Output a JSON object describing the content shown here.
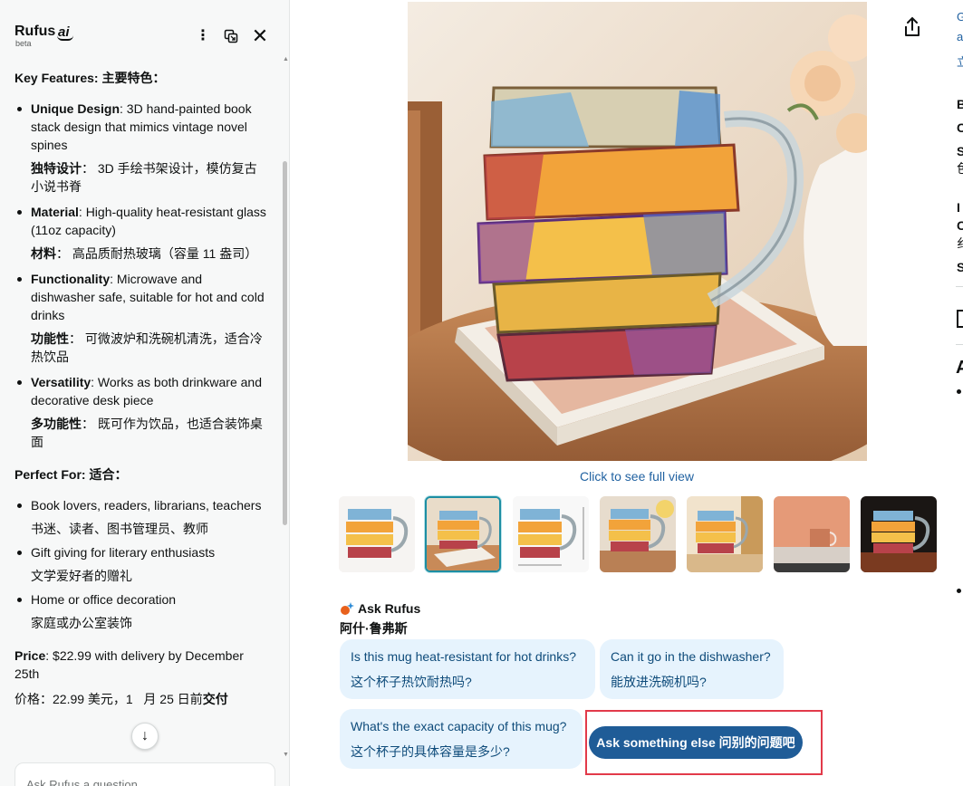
{
  "rufus": {
    "brand": "Rufus",
    "brand_ai": "ai",
    "brand_beta": "beta",
    "more_icon": "⋮",
    "close_icon": "✕",
    "key_features_title": "Key Features: 主要特色：",
    "features": [
      {
        "label_en": "Unique Design",
        "text_en": ": 3D hand-painted book stack design that mimics vintage novel spines",
        "label_zh": "独特设计",
        "text_zh": "： 3D 手绘书架设计，模仿复古小说书脊"
      },
      {
        "label_en": "Material",
        "text_en": ": High-quality heat-resistant glass (11oz capacity)",
        "label_zh": "材料",
        "text_zh": "： 高品质耐热玻璃（容量 11 盎司）"
      },
      {
        "label_en": "Functionality",
        "text_en": ": Microwave and dishwasher safe, suitable for hot and cold drinks",
        "label_zh": "功能性",
        "text_zh": "： 可微波炉和洗碗机清洗，适合冷热饮品"
      },
      {
        "label_en": "Versatility",
        "text_en": ": Works as both drinkware and decorative desk piece",
        "label_zh": "多功能性",
        "text_zh": "： 既可作为饮品，也适合装饰桌面"
      }
    ],
    "perfect_for_title": "Perfect For: 适合：",
    "perfect_for": [
      {
        "en": "Book lovers, readers, librarians, teachers",
        "zh": "书迷、读者、图书管理员、教师"
      },
      {
        "en": "Gift giving for literary enthusiasts",
        "zh": "文学爱好者的赠礼"
      },
      {
        "en": "Home or office decoration",
        "zh": "家庭或办公室装饰"
      }
    ],
    "price_label": "Price",
    "price_text": ": $22.99 with delivery by December 25th",
    "price_zh_a": "价格：22.99 美元，1",
    "price_zh_b": "月 25 日前",
    "price_zh_c": "交付",
    "jump_icon": "↓",
    "ask_placeholder": "Ask Rufus a question"
  },
  "product": {
    "full_view_link": "Click to see full view",
    "thumbnail_count": 7,
    "selected_thumbnail": 2
  },
  "ask": {
    "title": "Ask Rufus",
    "subtitle": "阿什·鲁弗斯",
    "chips": [
      {
        "en": "Is this mug heat-resistant for hot drinks?",
        "zh": "这个杯子热饮耐热吗?"
      },
      {
        "en": "Can it go in the dishwasher?",
        "zh": "能放进洗碗机吗?"
      },
      {
        "en": "What's the exact capacity of this mug?",
        "zh": "这个杯子的具体容量是多少?"
      }
    ],
    "ask_else": "Ask something else  问别的问题吧"
  },
  "right_column": {
    "r1": "G",
    "r2": "a",
    "r3": "立",
    "r4": "B",
    "r5": "C",
    "r6": "S",
    "r7": "色",
    "r8": "I",
    "r9": "C",
    "r10": "纟",
    "r11": "S",
    "r12": "A"
  },
  "colors": {
    "accent_link": "#2162a1",
    "chip_bg": "#e6f3fd",
    "ask_button": "#1f5c97",
    "highlight_border": "#e23a4a",
    "selected_thumb_border": "#1d8ea3"
  }
}
